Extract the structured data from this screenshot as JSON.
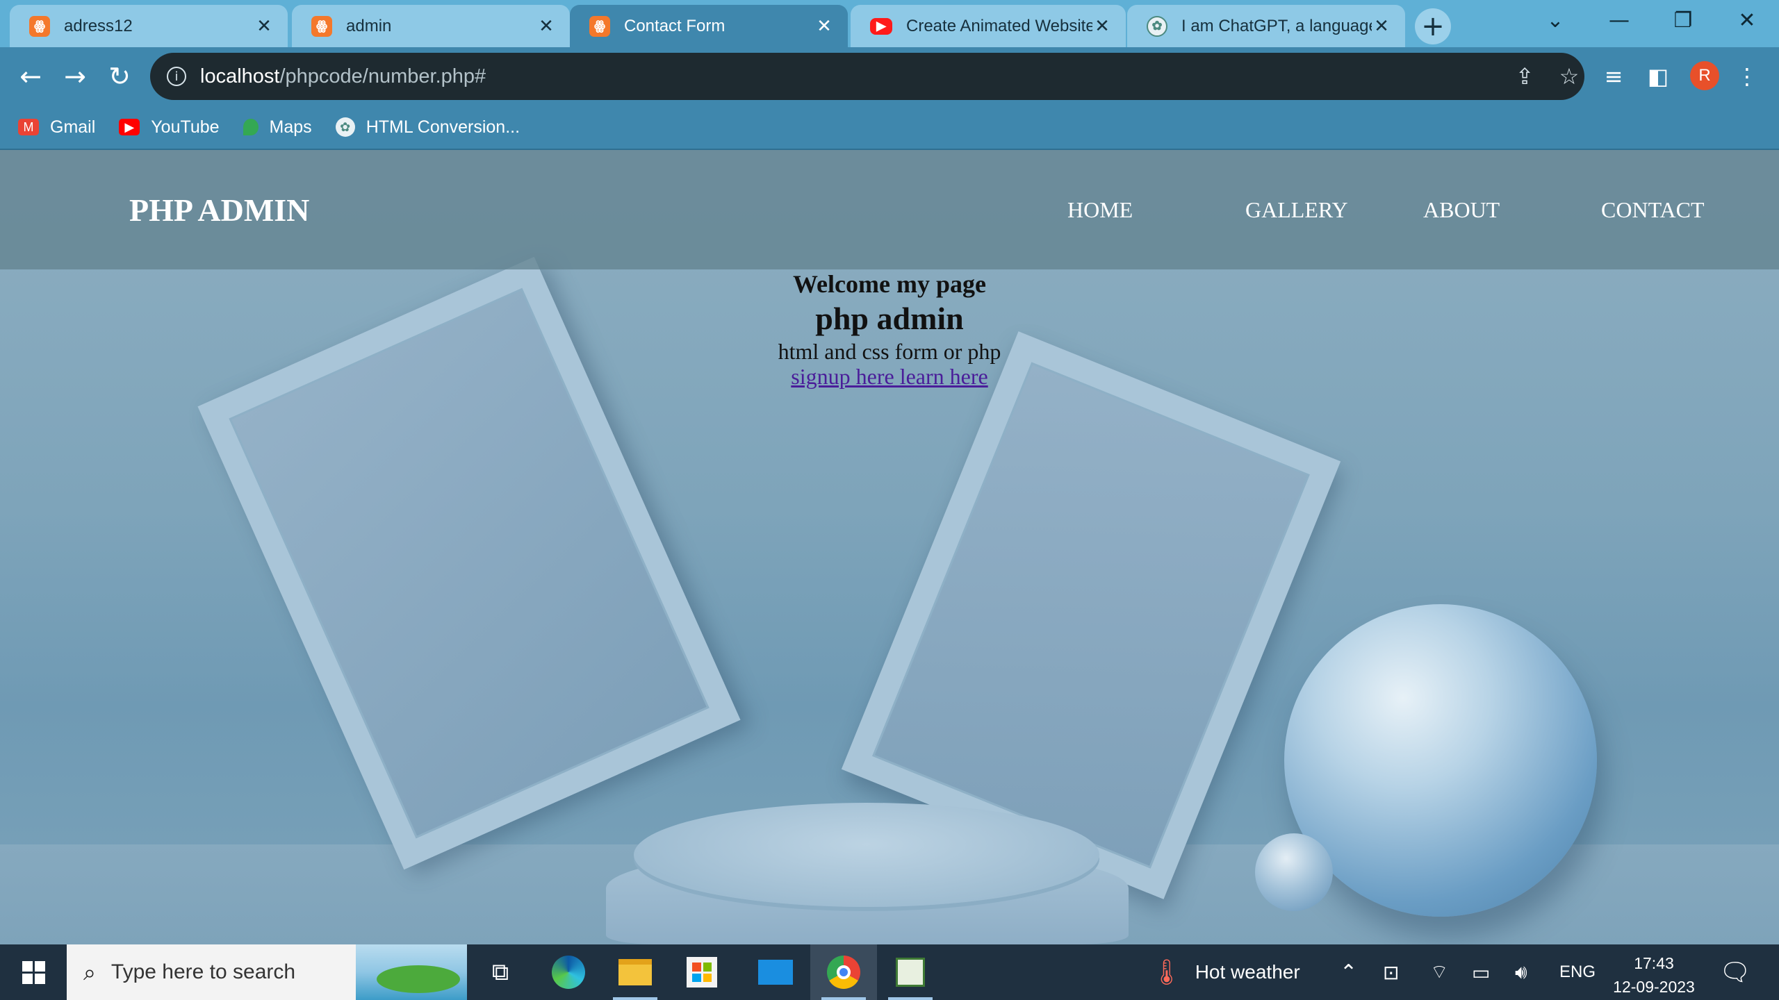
{
  "browser": {
    "tabs": [
      {
        "title": "adress12",
        "icon": "xampp-icon",
        "active": false
      },
      {
        "title": "admin",
        "icon": "xampp-icon",
        "active": false
      },
      {
        "title": "Contact Form",
        "icon": "xampp-icon",
        "active": true
      },
      {
        "title": "Create Animated Website",
        "icon": "youtube-icon",
        "active": false
      },
      {
        "title": "I am ChatGPT, a language",
        "icon": "chatgpt-icon",
        "active": false
      }
    ],
    "url_host": "localhost",
    "url_path": "/phpcode/number.php#",
    "profile_initial": "R",
    "bookmarks": [
      {
        "label": "Gmail",
        "icon": "gmail-icon"
      },
      {
        "label": "YouTube",
        "icon": "youtube-icon"
      },
      {
        "label": "Maps",
        "icon": "maps-icon"
      },
      {
        "label": "HTML Conversion...",
        "icon": "chatgpt-icon"
      }
    ]
  },
  "site": {
    "brand": "PHP ADMIN",
    "nav": [
      "HOME",
      "GALLERY",
      "ABOUT",
      "CONTACT"
    ],
    "hero": {
      "heading_small": "Welcome my page",
      "heading_large": "php admin",
      "subtitle": "html and css form or php",
      "link": "signup here learn here"
    }
  },
  "taskbar": {
    "search_placeholder": "Type here to search",
    "weather": "Hot weather",
    "language": "ENG",
    "time": "17:43",
    "date": "12-09-2023"
  },
  "colors": {
    "tabstrip": "#5fb0d6",
    "toolbar": "#3f87ad",
    "omnibox": "#1e2a30",
    "navbar": "#60808c",
    "link": "#4a1d99",
    "taskbar": "#1f3040"
  }
}
